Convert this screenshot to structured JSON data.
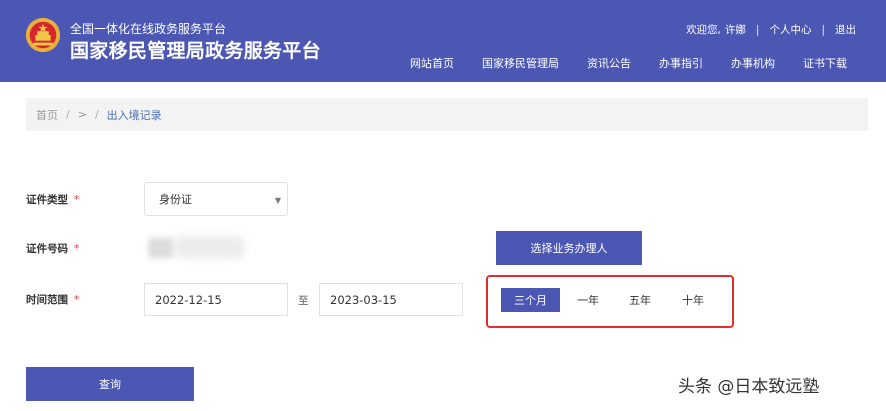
{
  "header": {
    "subtitle": "全国一体化在线政务服务平台",
    "title": "国家移民管理局政务服务平台",
    "welcome": "欢迎您,",
    "username": "许娜",
    "personal_center": "个人中心",
    "logout": "退出",
    "nav": [
      "网站首页",
      "国家移民管理局",
      "资讯公告",
      "办事指引",
      "办事机构",
      "证书下载"
    ],
    "bg_color": "#4b57b3"
  },
  "breadcrumb": {
    "home": "首页",
    "sep1": "/",
    "middle": ">",
    "sep2": "/",
    "current": "出入境记录"
  },
  "form": {
    "id_type_label": "证件类型",
    "id_type_value": "身份证",
    "id_number_label": "证件号码",
    "required_mark": "*",
    "select_agent_button": "选择业务办理人",
    "time_range_label": "时间范围",
    "start_date": "2022-12-15",
    "to_text": "至",
    "end_date": "2023-03-15",
    "ranges": [
      {
        "label": "三个月",
        "active": true
      },
      {
        "label": "一年",
        "active": false
      },
      {
        "label": "五年",
        "active": false
      },
      {
        "label": "十年",
        "active": false
      }
    ],
    "query_button": "查询"
  },
  "watermark": "头条 @日本致远塾",
  "colors": {
    "primary": "#4b57b3",
    "highlight_border": "#e02e2e",
    "required": "#e53935"
  }
}
